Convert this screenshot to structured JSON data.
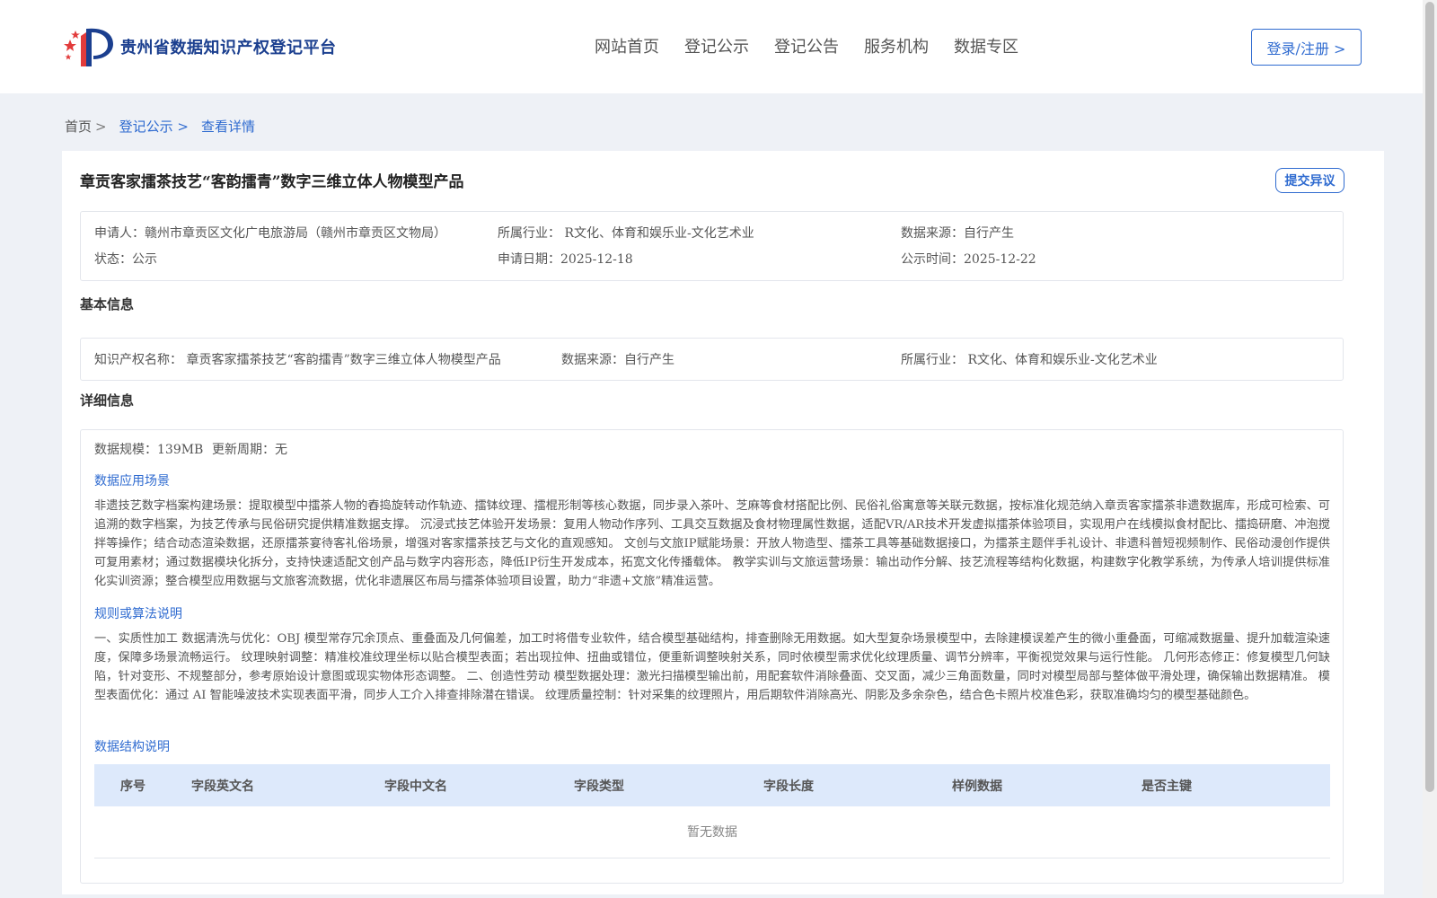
{
  "header": {
    "logo_text": "贵州省数据知识产权登记平台",
    "nav": [
      "网站首页",
      "登记公示",
      "登记公告",
      "服务机构",
      "数据专区"
    ],
    "login_label": "登录/注册 >"
  },
  "breadcrumb": {
    "home": "首页",
    "sep": ">",
    "items": [
      "登记公示 >",
      "查看详情"
    ]
  },
  "record": {
    "title": "章贡客家擂茶技艺“客韵擂青”数字三维立体人物模型产品",
    "dispute_label": "提交异议",
    "applicant": "申请人：赣州市章贡区文化广电旅游局（赣州市章贡区文物局）",
    "industry": "所属行业： R文化、体育和娱乐业-文化艺术业",
    "source": "数据来源：自行产生",
    "status": "状态：公示",
    "apply_date": "申请日期：2025-12-18",
    "publish_date": "公示时间：2025-12-22"
  },
  "basic": {
    "section_title": "基本信息",
    "ip_name": "知识产权名称： 章贡客家擂茶技艺“客韵擂青”数字三维立体人物模型产品",
    "source": "数据来源：自行产生",
    "industry": "所属行业： R文化、体育和娱乐业-文化艺术业"
  },
  "detail": {
    "section_title": "详细信息",
    "scale": "数据规模：139MB",
    "cycle": "更新周期：无",
    "scene_title": "数据应用场景",
    "scene_text": "非遗技艺数字档案构建场景：提取模型中擂茶人物的舂捣旋转动作轨迹、擂钵纹理、擂棍形制等核心数据，同步录入茶叶、芝麻等食材搭配比例、民俗礼俗寓意等关联元数据，按标准化规范纳入章贡客家擂茶非遗数据库，形成可检索、可追溯的数字档案，为技艺传承与民俗研究提供精准数据支撑。 沉浸式技艺体验开发场景：复用人物动作序列、工具交互数据及食材物理属性数据，适配VR/AR技术开发虚拟擂茶体验项目，实现用户在线模拟食材配比、擂捣研磨、冲泡搅拌等操作；结合动态渲染数据，还原擂茶宴待客礼俗场景，增强对客家擂茶技艺与文化的直观感知。 文创与文旅IP赋能场景：开放人物造型、擂茶工具等基础数据接口，为擂茶主题伴手礼设计、非遗科普短视频制作、民俗动漫创作提供可复用素材；通过数据模块化拆分，支持快速适配文创产品与数字内容形态，降低IP衍生开发成本，拓宽文化传播载体。 教学实训与文旅运营场景：输出动作分解、技艺流程等结构化数据，构建数字化教学系统，为传承人培训提供标准化实训资源；整合模型应用数据与文旅客流数据，优化非遗展区布局与擂茶体验项目设置，助力“非遗+文旅”精准运营。",
    "rule_title": "规则或算法说明",
    "rule_text": "一、实质性加工 数据清洗与优化：OBJ 模型常存冗余顶点、重叠面及几何偏差，加工时将借专业软件，结合模型基础结构，排查删除无用数据。如大型复杂场景模型中，去除建模误差产生的微小重叠面，可缩减数据量、提升加载渲染速度，保障多场景流畅运行。 纹理映射调整：精准校准纹理坐标以贴合模型表面；若出现拉伸、扭曲或错位，便重新调整映射关系，同时依模型需求优化纹理质量、调节分辨率，平衡视觉效果与运行性能。 几何形态修正：修复模型几何缺陷，针对变形、不规整部分，参考原始设计意图或现实物体形态调整。 二、创造性劳动 模型数据处理：激光扫描模型输出前，用配套软件消除叠面、交叉面，减少三角面数量，同时对模型局部与整体做平滑处理，确保输出数据精准。 模型表面优化：通过 AI 智能噪波技术实现表面平滑，同步人工介入排查排除潜在错误。 纹理质量控制：针对采集的纹理照片，用后期软件消除高光、阴影及多余杂色，结合色卡照片校准色彩，获取准确均匀的模型基础颜色。",
    "struct_title": "数据结构说明",
    "table_headers": [
      "序号",
      "字段英文名",
      "字段中文名",
      "字段类型",
      "字段长度",
      "样例数据",
      "是否主键"
    ],
    "empty_text": "暂无数据"
  }
}
